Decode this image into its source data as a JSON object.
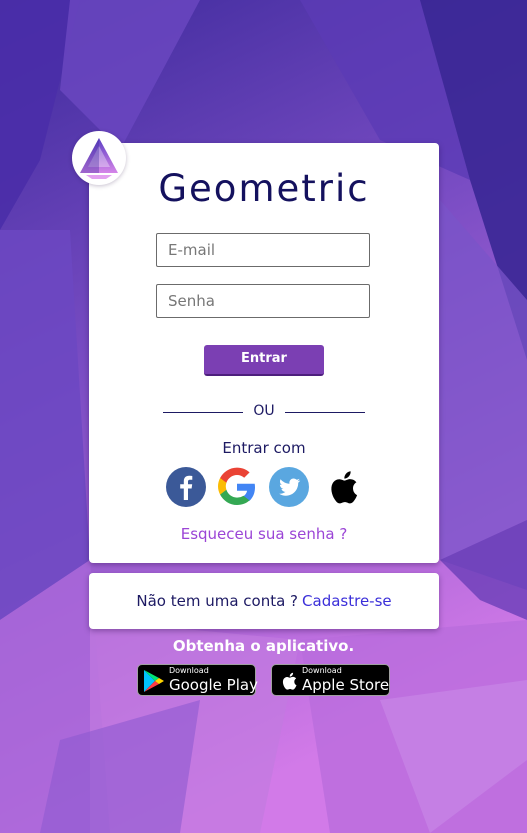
{
  "brand": {
    "name": "Geometric"
  },
  "login": {
    "email_placeholder": "E-mail",
    "password_placeholder": "Senha",
    "submit_label": "Entrar",
    "divider_text": "OU",
    "social_label": "Entrar com",
    "social": [
      {
        "name": "facebook",
        "icon": "facebook-icon"
      },
      {
        "name": "google",
        "icon": "google-icon"
      },
      {
        "name": "twitter",
        "icon": "twitter-icon"
      },
      {
        "name": "apple",
        "icon": "apple-icon"
      }
    ],
    "forgot_label": "Esqueceu sua senha ?"
  },
  "signup": {
    "prompt": "Não tem uma conta ?",
    "link_label": "Cadastre-se"
  },
  "apps": {
    "heading": "Obtenha o aplicativo.",
    "google_play": {
      "small": "Download",
      "big": "Google Play"
    },
    "apple_store": {
      "small": "Download",
      "big": "Apple Store"
    }
  },
  "colors": {
    "accent": "#7b3fb3",
    "brand_text": "#14115e",
    "link": "#3b2fd9",
    "forgot": "#9b45d6"
  }
}
